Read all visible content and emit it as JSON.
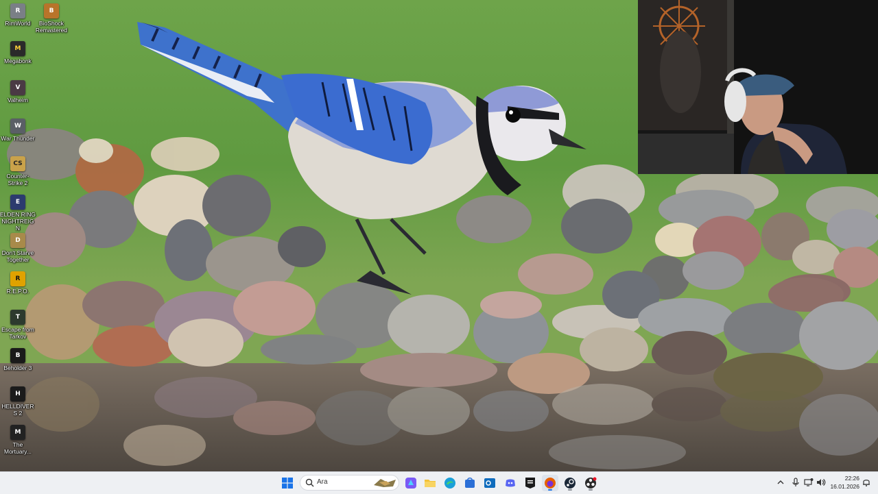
{
  "desktop": {
    "icons": [
      {
        "label": "RimWorld",
        "icon": "rimworld-icon",
        "color": "#7a7f86",
        "glyph": "R"
      },
      {
        "label": "BioShock Remastered",
        "icon": "bioshock-icon",
        "color": "#b8742a",
        "glyph": "B"
      },
      {
        "label": "Megabonk",
        "icon": "megabonk-icon",
        "color": "#2a2a2a",
        "glyph": "M"
      },
      {
        "label": "Valheim",
        "icon": "valheim-icon",
        "color": "#4a3a44",
        "glyph": "V"
      },
      {
        "label": "War Thunder",
        "icon": "war-thunder-icon",
        "color": "#5a5f66",
        "glyph": "W"
      },
      {
        "label": "Counter-Strike 2",
        "icon": "counter-strike-icon",
        "color": "#c9a24a",
        "glyph": "CS"
      },
      {
        "label": "ELDEN RING NIGHTREIGN",
        "icon": "elden-ring-icon",
        "color": "#2c3b6e",
        "glyph": "E"
      },
      {
        "label": "Don't Starve Together",
        "icon": "dont-starve-icon",
        "color": "#a88a4a",
        "glyph": "D"
      },
      {
        "label": "R.E.P.O.",
        "icon": "repo-icon",
        "color": "#e0a200",
        "glyph": "R"
      },
      {
        "label": "Escape from Tarkov",
        "icon": "tarkov-icon",
        "color": "#2d3a2e",
        "glyph": "T"
      },
      {
        "label": "Beholder 3",
        "icon": "beholder-icon",
        "color": "#1a1a1a",
        "glyph": "B"
      },
      {
        "label": "HELLDIVERS 2",
        "icon": "helldivers-icon",
        "color": "#1b1b1b",
        "glyph": "H"
      },
      {
        "label": "The Mortuary...",
        "icon": "mortuary-icon",
        "color": "#222222",
        "glyph": "M"
      }
    ]
  },
  "taskbar": {
    "search_placeholder": "Ara",
    "apps": [
      {
        "name": "start-button",
        "icon": "windows-start-icon",
        "color": "#1a73e8"
      },
      {
        "name": "copilot-button",
        "icon": "copilot-icon",
        "color": "#7a5af5"
      },
      {
        "name": "file-explorer-button",
        "icon": "folder-icon",
        "color": "#f3c238"
      },
      {
        "name": "edge-button",
        "icon": "edge-icon",
        "color": "#1aa0d8"
      },
      {
        "name": "store-button",
        "icon": "store-icon",
        "color": "#2b6fd6"
      },
      {
        "name": "outlook-button",
        "icon": "outlook-icon",
        "color": "#0f6cbd"
      },
      {
        "name": "discord-button",
        "icon": "discord-icon",
        "color": "#5865f2"
      },
      {
        "name": "epic-games-button",
        "icon": "epic-games-icon",
        "color": "#1b1b1b"
      },
      {
        "name": "firefox-button",
        "icon": "firefox-icon",
        "color": "#e66000"
      },
      {
        "name": "steam-button",
        "icon": "steam-icon",
        "color": "#1b2838"
      },
      {
        "name": "obs-button",
        "icon": "obs-icon",
        "color": "#2a2a2a"
      }
    ],
    "tray": {
      "time": "22:26",
      "date": "16.01.2026"
    }
  },
  "wallpaper": {
    "subject": "blue-jay-on-stones",
    "colors": {
      "sky": "#6f9c4a",
      "water": "#5a5045",
      "bird_blue": "#3f6fc8"
    }
  }
}
